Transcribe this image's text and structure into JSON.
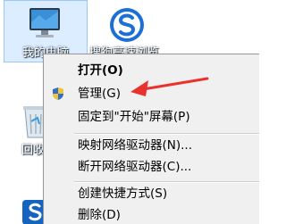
{
  "desktop": {
    "icons": [
      {
        "label": "我的电脑"
      },
      {
        "label": "搜狗高速浏览"
      },
      {
        "label": "回收"
      }
    ]
  },
  "context_menu": {
    "items": [
      {
        "label": "打开(O)"
      },
      {
        "label": "管理(G)"
      },
      {
        "label": "固定到\"开始\"屏幕(P)"
      },
      {
        "label": "映射网络驱动器(N)..."
      },
      {
        "label": "断开网络驱动器(C)..."
      },
      {
        "label": "创建快捷方式(S)"
      },
      {
        "label": "删除(D)"
      }
    ]
  },
  "annotation": {
    "arrow_color": "#e8322e"
  },
  "colors": {
    "menu_bg": "#f0f0f0",
    "selection_bg": "#99ccff"
  }
}
